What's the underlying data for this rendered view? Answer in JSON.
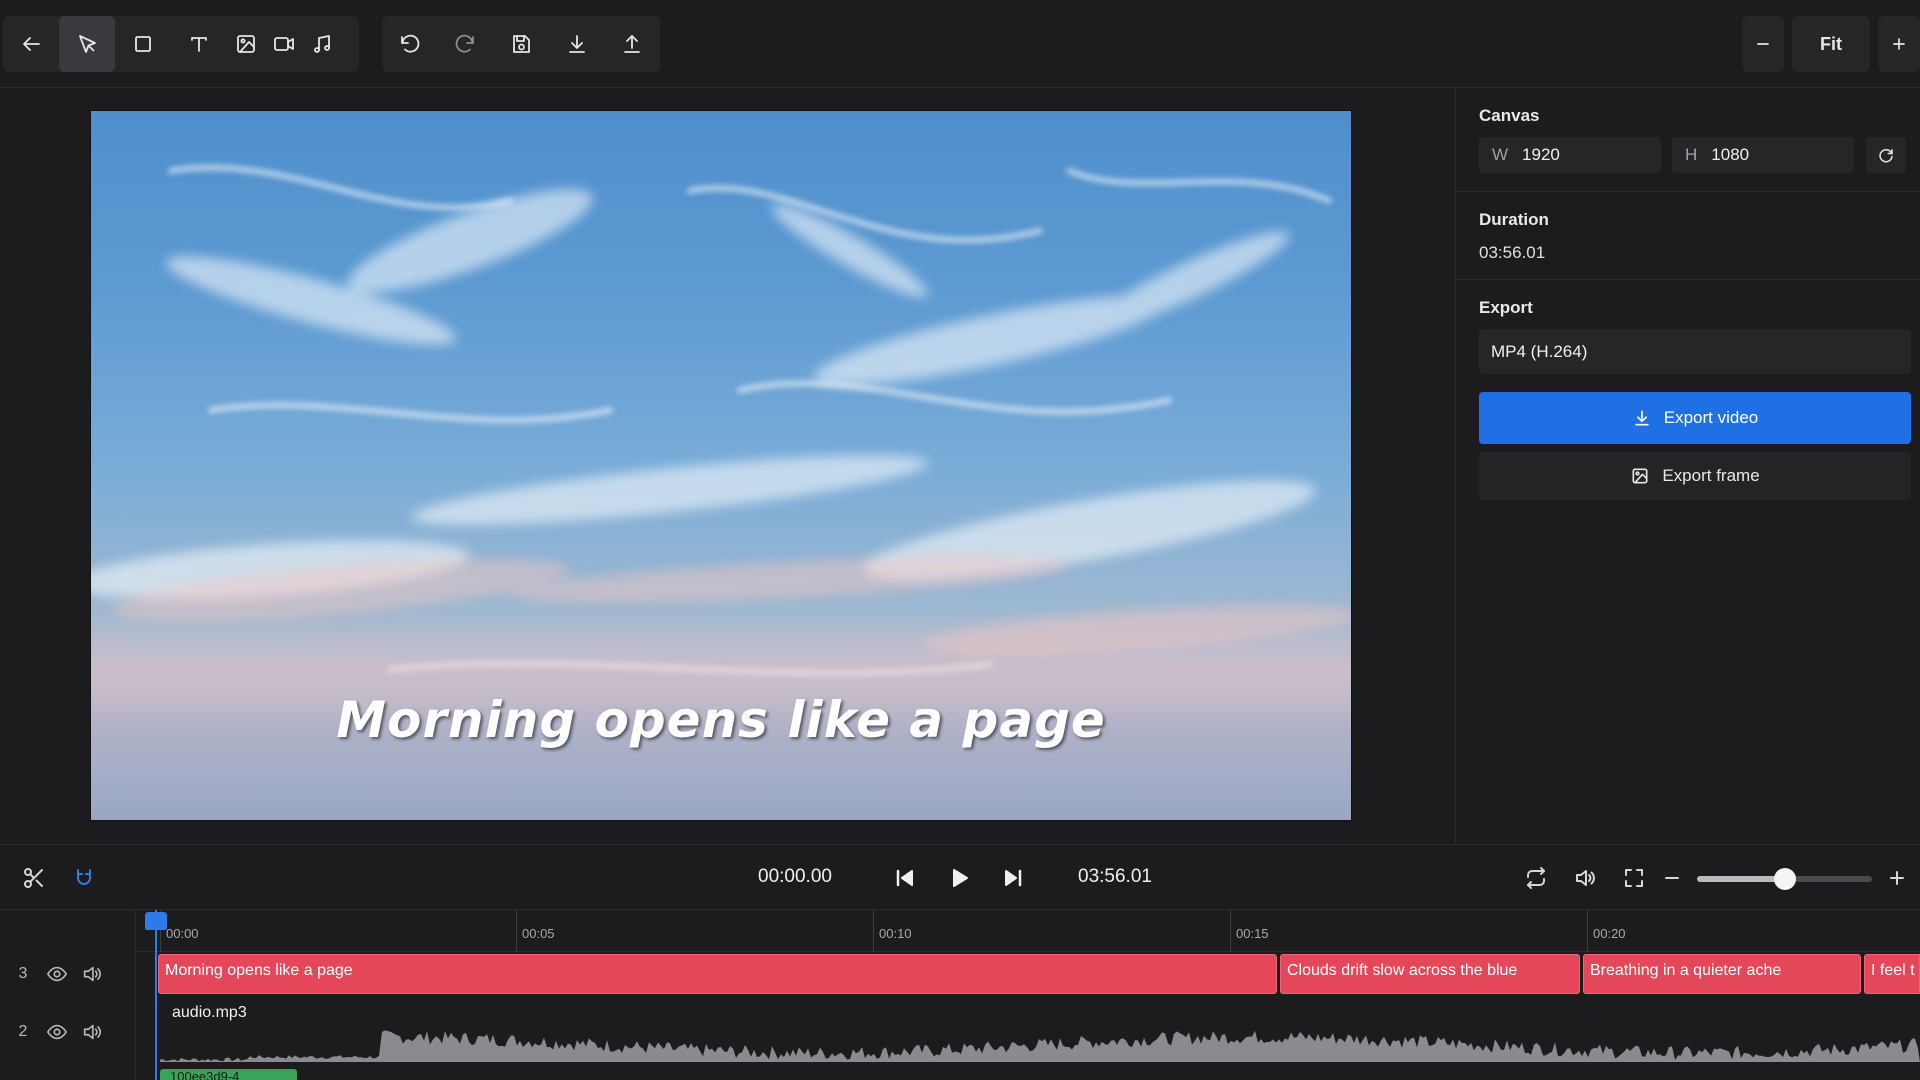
{
  "toolbar": {
    "tools": [
      "back-arrow-icon",
      "select-cursor-icon",
      "rectangle-icon",
      "text-icon",
      "image-icon",
      "video-icon",
      "music-icon"
    ],
    "history": [
      "undo-icon",
      "redo-icon",
      "save-icon",
      "download-icon",
      "upload-icon"
    ],
    "zoom": {
      "minus": "minus-icon",
      "label": "Fit",
      "plus": "plus-icon"
    }
  },
  "preview": {
    "caption": "Morning opens like a page"
  },
  "panel": {
    "canvas": {
      "title": "Canvas",
      "w_label": "W",
      "w_value": "1920",
      "h_label": "H",
      "h_value": "1080"
    },
    "duration": {
      "title": "Duration",
      "value": "03:56.01"
    },
    "export": {
      "title": "Export",
      "format": "MP4 (H.264)",
      "export_video_label": "Export video",
      "export_frame_label": "Export frame"
    },
    "accent": "#1f6fe5"
  },
  "playback": {
    "current_time": "00:00.00",
    "total_time": "03:56.01",
    "zoom_level": 0.5
  },
  "timeline": {
    "ticks": [
      "00:00",
      "00:05",
      "00:10",
      "00:15",
      "00:20"
    ],
    "rows": [
      {
        "num": "3",
        "kind": "captions"
      },
      {
        "num": "2",
        "kind": "audio"
      }
    ],
    "caption_clips": [
      "Morning opens like a page",
      "Clouds drift slow across the blue",
      "Breathing in a quieter ache",
      "I feel t"
    ],
    "audio_clip": "audio.mp3",
    "video_clip": "100ee3d9-4",
    "clip_color": "#e5475a",
    "playhead_color": "#2e7be8"
  }
}
